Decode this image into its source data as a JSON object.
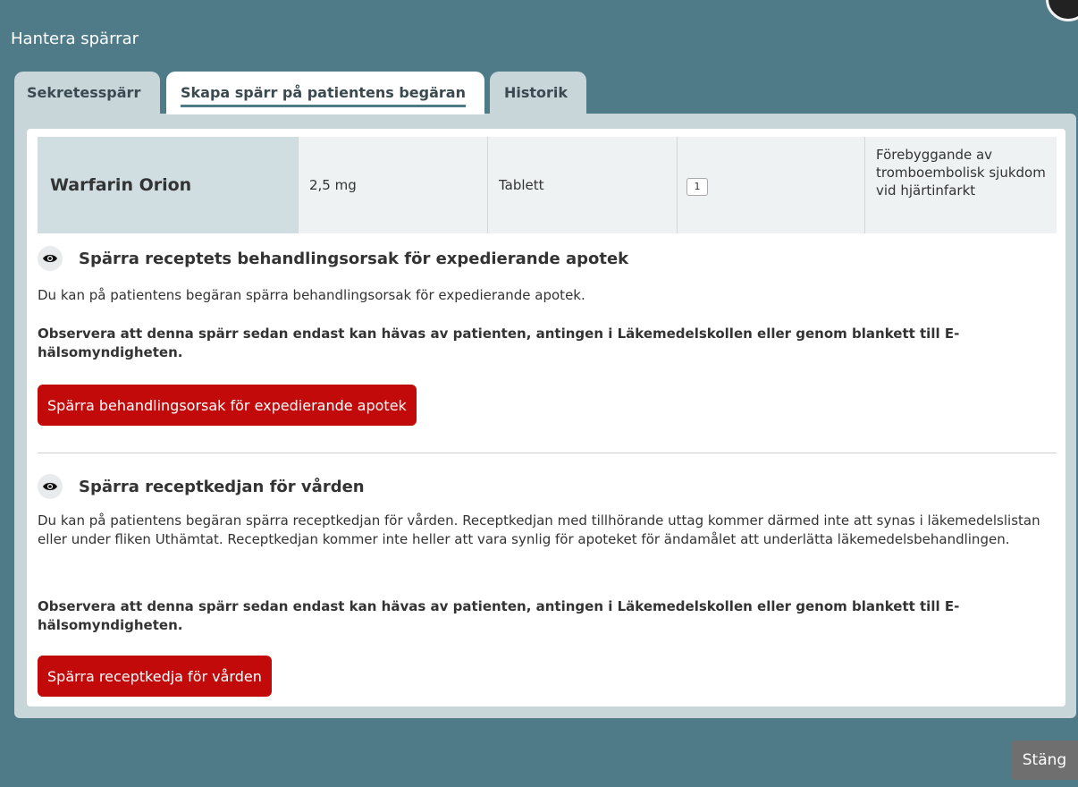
{
  "modal": {
    "title": "Hantera spärrar"
  },
  "tabs": [
    {
      "label": "Sekretesspärr"
    },
    {
      "label": "Skapa spärr på patientens begäran"
    },
    {
      "label": "Historik"
    }
  ],
  "drug": {
    "name": "Warfarin Orion",
    "strength": "2,5 mg",
    "form": "Tablett",
    "count": "1",
    "reason": "Förebyggande av tromboembolisk sjukdom vid hjärtinfarkt"
  },
  "section1": {
    "heading": "Spärra receptets behandlingsorsak för expedierande apotek",
    "description": "Du kan på patientens begäran spärra behandlingsorsak för expedierande apotek.",
    "warning": "Observera att denna spärr sedan endast kan hävas av patienten, antingen i Läkemedelskollen eller genom blankett till E-hälsomyndigheten.",
    "button_label": "Spärra behandlingsorsak för expedierande apotek"
  },
  "section2": {
    "heading": "Spärra receptkedjan för vården",
    "description": "Du kan på patientens begäran spärra receptkedjan för vården. Receptkedjan med tillhörande uttag kommer därmed inte att synas i läkemedelslistan eller under fliken Uthämtat. Receptkedjan kommer inte heller att vara synlig för apoteket för ändamålet att underlätta läkemedelsbehandlingen.",
    "warning": "Observera att denna spärr sedan endast kan hävas av patienten, antingen i Läkemedelskollen eller genom blankett till E-hälsomyndigheten.",
    "button_label": "Spärra receptkedja för vården"
  },
  "footer": {
    "close_label": "Stäng"
  },
  "icons": {
    "eye": "eye-icon"
  },
  "colors": {
    "accent_red": "#c30a0a",
    "backdrop": "#4f7b89",
    "close_button": "#6f6f6f"
  }
}
